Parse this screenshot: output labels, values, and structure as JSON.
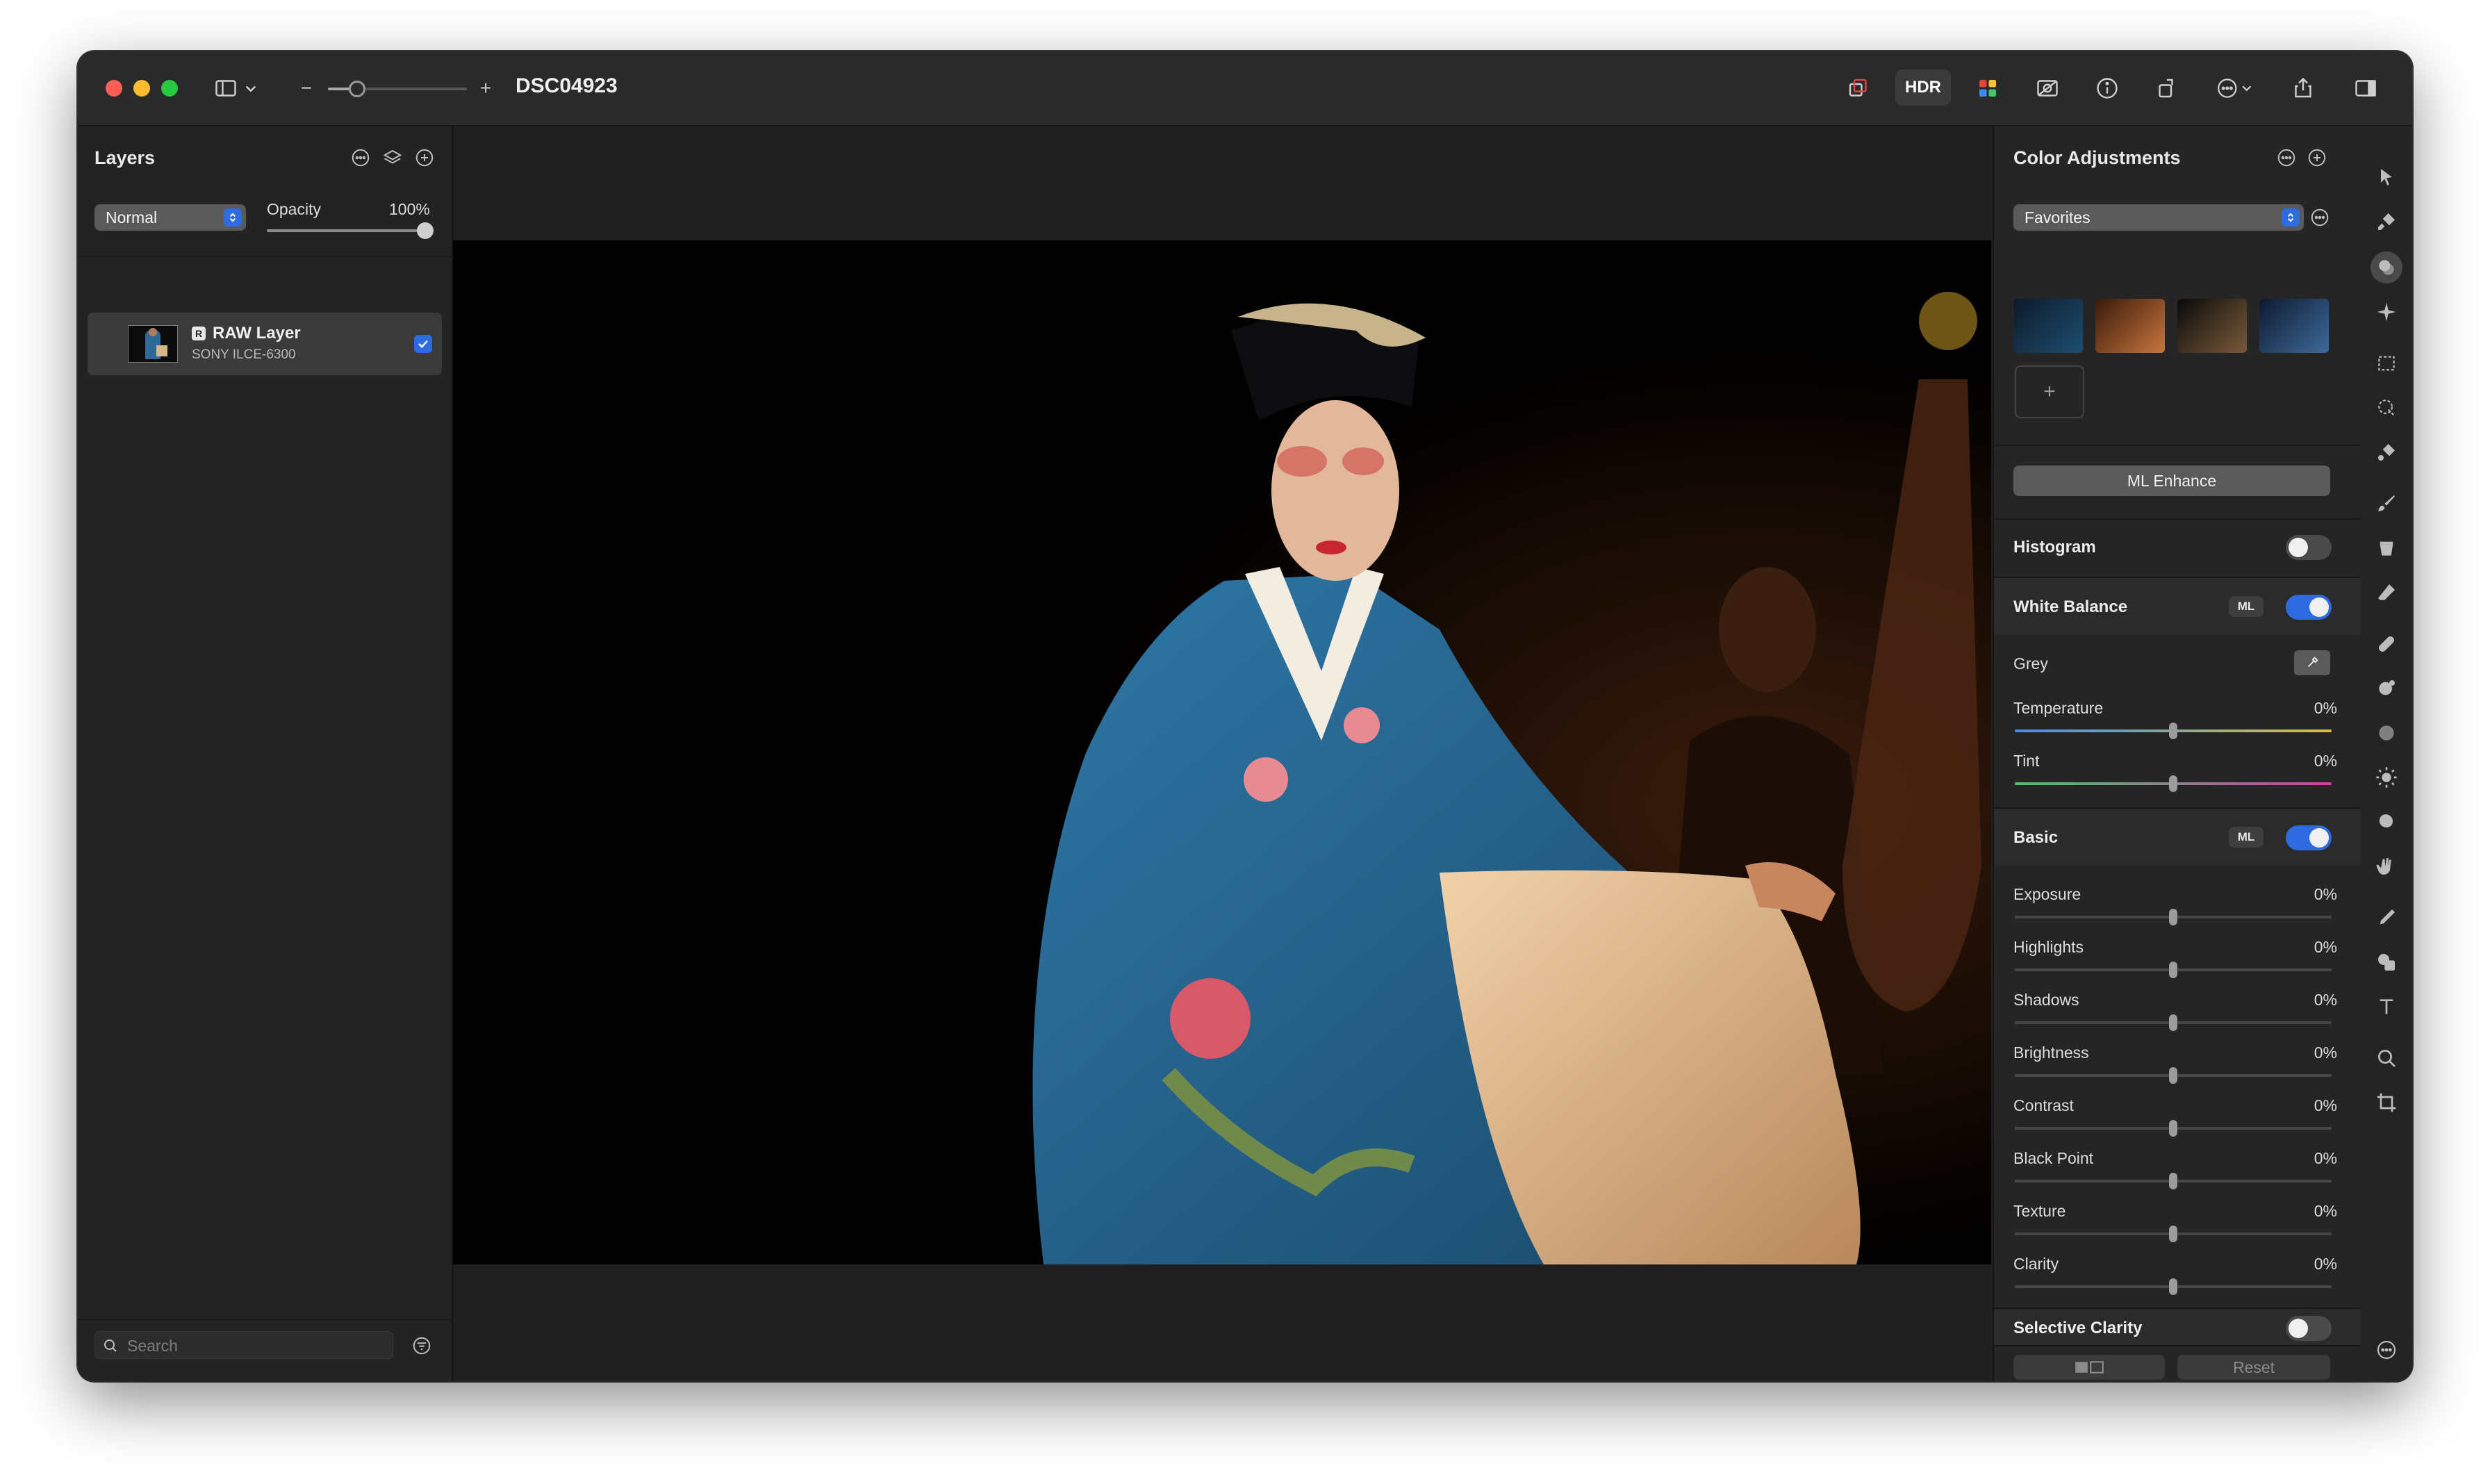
{
  "window": {
    "title": "DSC04923",
    "traffic_lights": [
      "#ff5f57",
      "#febc2e",
      "#28c840"
    ]
  },
  "toolbar": {
    "left_icons": [
      "sidebar-icon",
      "chevron-down-icon",
      "zoom-out-icon",
      "zoom-slider",
      "zoom-in-icon"
    ],
    "zoom_minus": "−",
    "zoom_plus": "+",
    "hdr_label": "HDR",
    "right_icons": [
      "layer-copy-icon",
      "hdr-button",
      "color-grid-icon",
      "compare-icon",
      "info-icon",
      "rotate-icon",
      "more-icon",
      "share-icon",
      "inspector-toggle-icon"
    ]
  },
  "layers_panel": {
    "title": "Layers",
    "blend_mode": "Normal",
    "opacity_label": "Opacity",
    "opacity_value": "100%",
    "opacity_fraction": 1.0,
    "layer": {
      "name": "RAW Layer",
      "badge": "R",
      "subtitle": "SONY ILCE-6300",
      "visible": true
    },
    "search_placeholder": "Search"
  },
  "color_adjustments": {
    "title": "Color Adjustments",
    "preset_select": "Favorites",
    "add_preset": "+",
    "ml_enhance_label": "ML Enhance",
    "histogram": {
      "label": "Histogram",
      "enabled": false
    },
    "white_balance": {
      "label": "White Balance",
      "ml_badge": "ML",
      "enabled": true,
      "grey_label": "Grey",
      "sliders": [
        {
          "label": "Temperature",
          "value": "0%"
        },
        {
          "label": "Tint",
          "value": "0%"
        }
      ]
    },
    "basic": {
      "label": "Basic",
      "ml_badge": "ML",
      "enabled": true,
      "sliders": [
        {
          "label": "Exposure",
          "value": "0%"
        },
        {
          "label": "Highlights",
          "value": "0%"
        },
        {
          "label": "Shadows",
          "value": "0%"
        },
        {
          "label": "Brightness",
          "value": "0%"
        },
        {
          "label": "Contrast",
          "value": "0%"
        },
        {
          "label": "Black Point",
          "value": "0%"
        },
        {
          "label": "Texture",
          "value": "0%"
        },
        {
          "label": "Clarity",
          "value": "0%"
        }
      ]
    },
    "selective_clarity": {
      "label": "Selective Clarity",
      "enabled": false
    },
    "reset_label": "Reset"
  },
  "tools": [
    "arrow-select-icon",
    "style-brush-icon",
    "color-adjust-icon",
    "effects-sparkle-icon",
    "rect-select-icon",
    "quick-select-icon",
    "smart-select-icon",
    "paint-brush-icon",
    "fill-bucket-icon",
    "eraser-icon",
    "retouch-bandage-icon",
    "clone-stamp-icon",
    "blur-icon",
    "light-icon",
    "sponge-icon",
    "smudge-hand-icon",
    "pen-icon",
    "shape-icon",
    "text-icon",
    "zoom-icon",
    "crop-icon",
    "more-tools-icon"
  ],
  "colors": {
    "accent": "#2f6be0",
    "panel": "#252525",
    "toolbar": "#2a2a2a"
  }
}
